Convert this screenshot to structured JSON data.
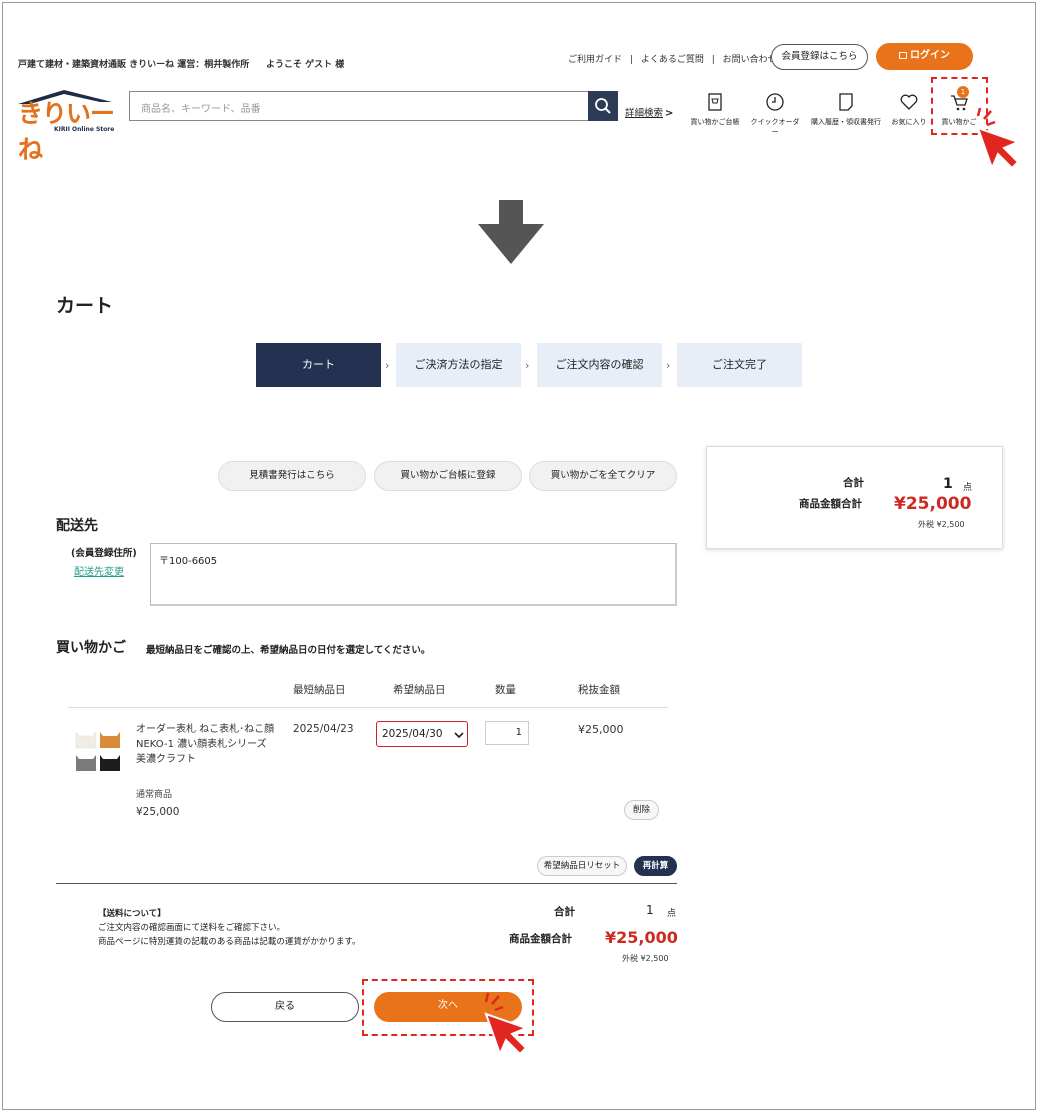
{
  "header": {
    "tagline": "戸建て建材・建築資材通販 きりいーね 運営：桐井製作所",
    "welcome": "ようこそ ゲスト 様",
    "links": [
      "ご利用ガイド",
      "|",
      "よくあるご質問",
      "|",
      "お問い合わせ"
    ],
    "register_label": "会員登録はこちら",
    "login_label": "ログイン",
    "logo_main": "きりいーね",
    "logo_sub": "KIRII Online Store",
    "search_placeholder": "商品名、キーワード、品番",
    "advanced_search": "詳細検索",
    "icons": [
      {
        "name": "shopping-ledger-icon",
        "label": "買い物かご台帳"
      },
      {
        "name": "quick-order-icon",
        "label": "クイックオーダー"
      },
      {
        "name": "purchase-history-icon",
        "label": "購入履歴・領収書発行"
      },
      {
        "name": "favorites-icon",
        "label": "お気に入り"
      },
      {
        "name": "cart-icon",
        "label": "買い物かご"
      }
    ],
    "cart_count": "1"
  },
  "cart": {
    "title": "カート",
    "steps": [
      "カート",
      "ご決済方法の指定",
      "ご注文内容の確認",
      "ご注文完了"
    ],
    "actions": [
      "見積書発行はこちら",
      "買い物かご台帳に登録",
      "買い物かごを全てクリア"
    ],
    "summary": {
      "total_label": "合計",
      "total_count": "1",
      "unit": "点",
      "amount_label": "商品金額合計",
      "amount": "¥25,000",
      "tax": "外税 ¥2,500"
    },
    "shipping": {
      "heading": "配送先",
      "addr_type": "(会員登録住所)",
      "change_link": "配送先変更",
      "address": "〒100-6605"
    },
    "basket": {
      "heading": "買い物かご",
      "note": "最短納品日をご確認の上、希望納品日の日付を選定してください。",
      "columns": [
        "最短納品日",
        "希望納品日",
        "数量",
        "税抜金額"
      ],
      "item": {
        "name_line1": "オーダー表札 ねこ表札･ねこ顔",
        "name_line2": "NEKO-1 濃い顔表札シリーズ",
        "name_line3": "美濃クラフト",
        "earliest": "2025/04/23",
        "desired": "2025/04/30",
        "qty": "1",
        "price": "¥25,000",
        "type": "通常商品",
        "type_price": "¥25,000",
        "delete_label": "削除"
      },
      "reset_label": "希望納品日リセット",
      "recalc_label": "再計算"
    },
    "footer": {
      "shipping_title": "【送料について】",
      "shipping_line1": "ご注文内容の確認画面にて送料をご確認下さい。",
      "shipping_line2": "商品ページに特別運賃の記載のある商品は記載の運賃がかかります。",
      "total_label": "合計",
      "total_count": "1",
      "unit": "点",
      "amount_label": "商品金額合計",
      "amount": "¥25,000",
      "tax": "外税 ¥2,500"
    },
    "back_label": "戻る",
    "next_label": "次へ"
  },
  "colors": {
    "accent": "#e8731a",
    "navy": "#233251",
    "price_red": "#cc2a22",
    "highlight_dash": "#e0261e"
  }
}
